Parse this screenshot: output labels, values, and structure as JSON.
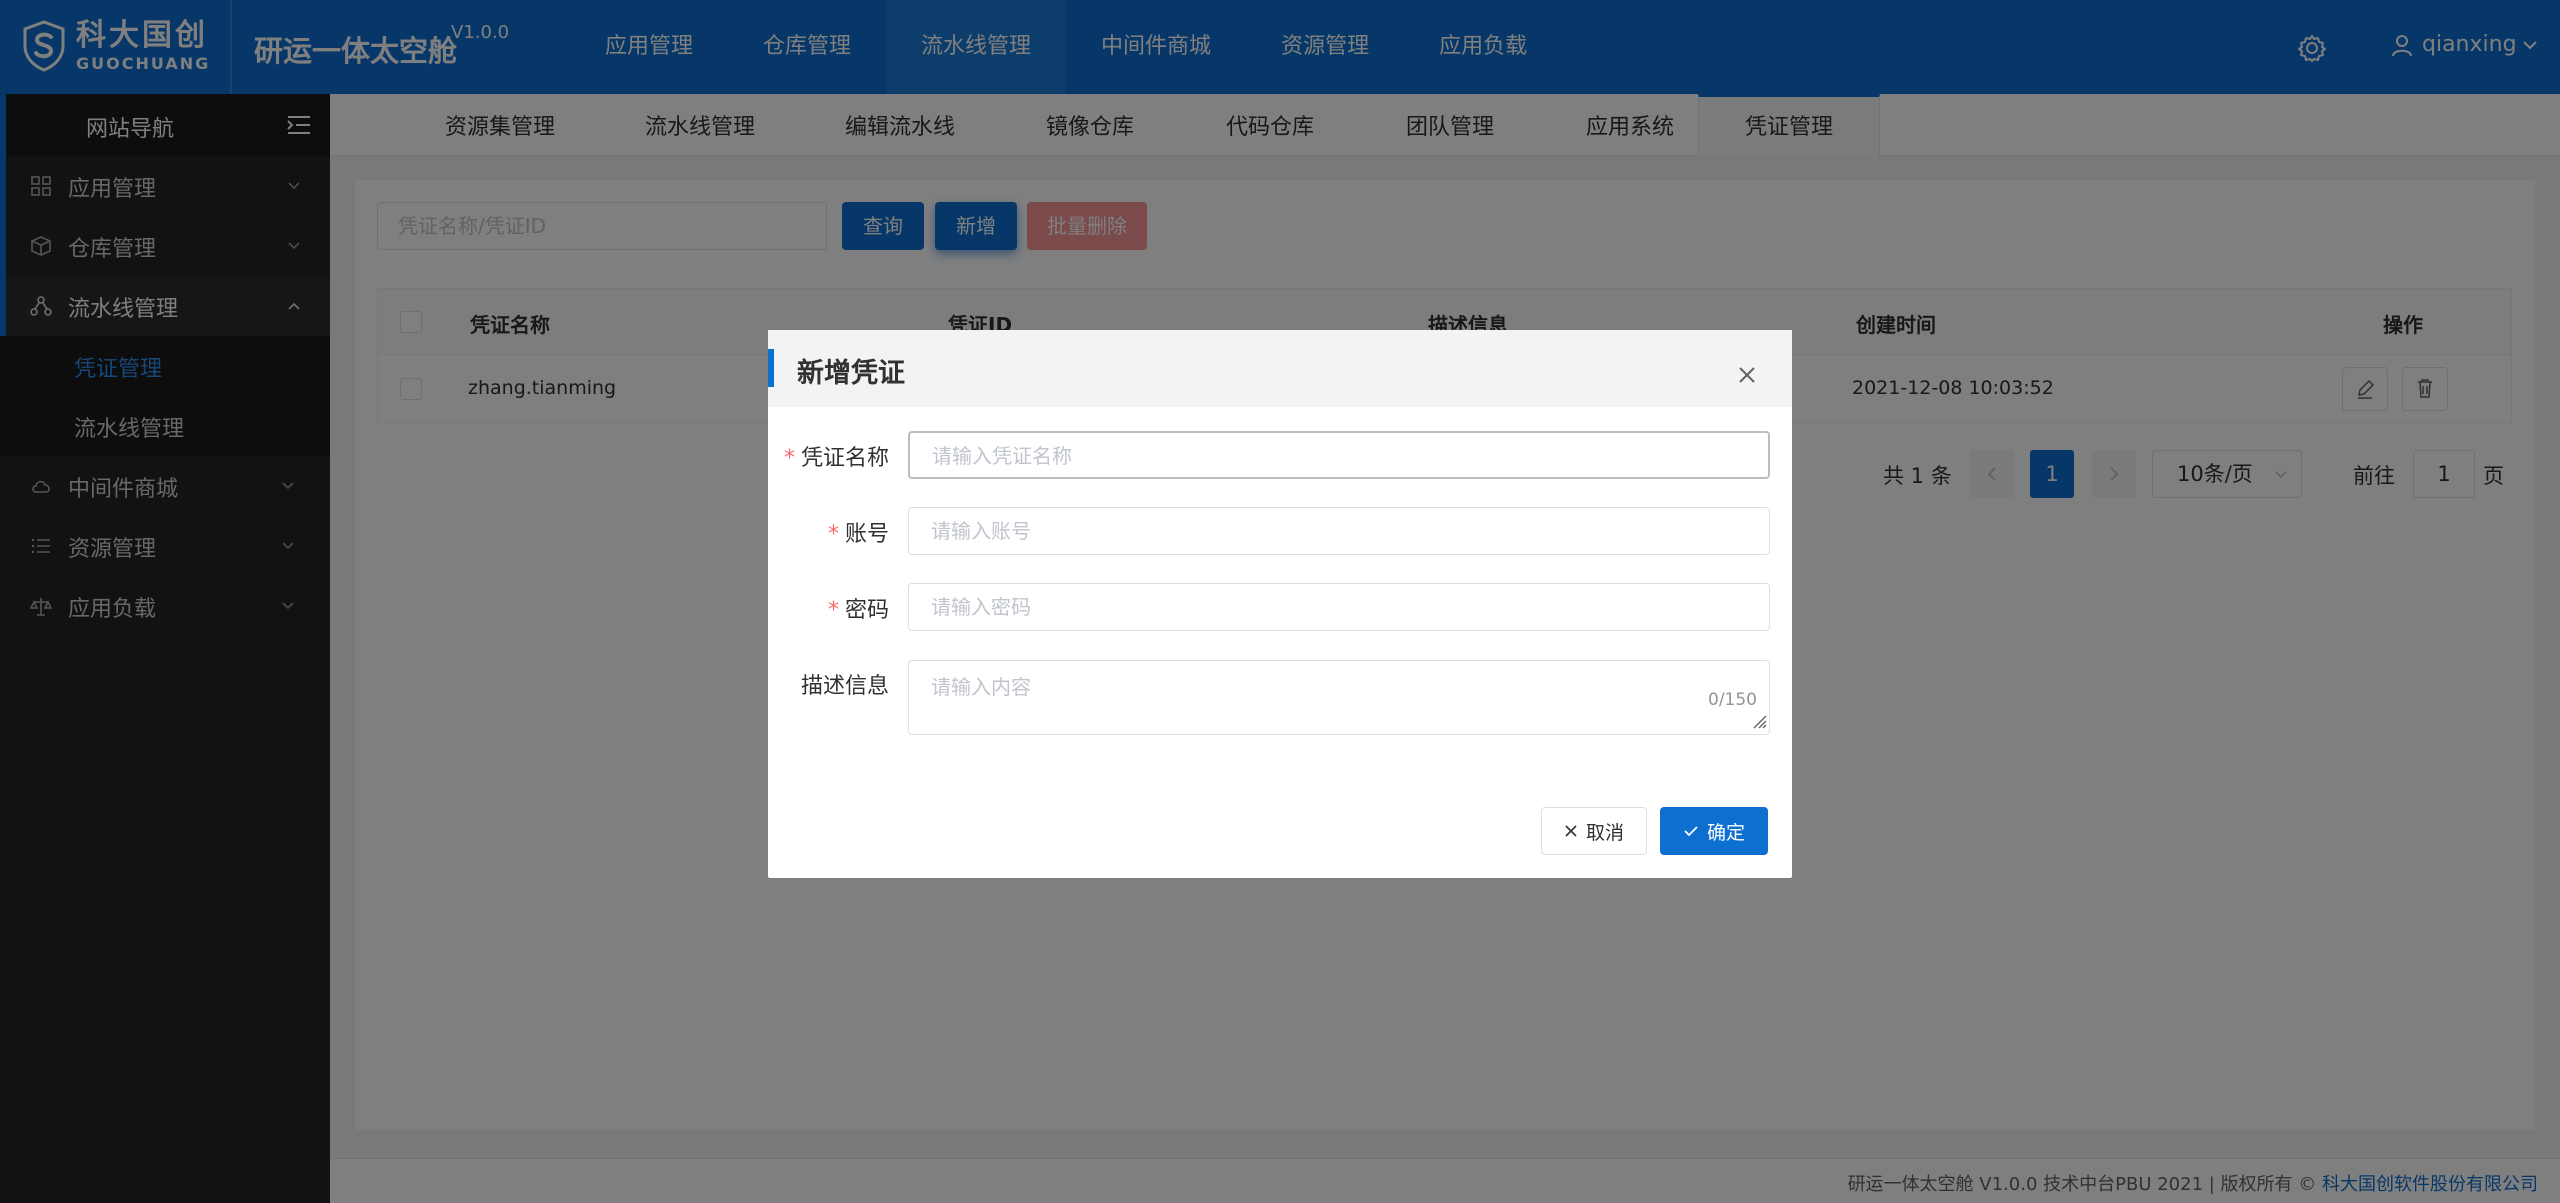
{
  "header": {
    "logo_cn": "科大国创",
    "logo_en": "GUOCHUANG",
    "app_title": "研运一体太空舱",
    "version": "V1.0.0",
    "nav": [
      "应用管理",
      "仓库管理",
      "流水线管理",
      "中间件商城",
      "资源管理",
      "应用负载"
    ],
    "active_nav": "流水线管理",
    "username": "qianxing",
    "icons": {
      "settings": "gear-icon",
      "user": "user-icon"
    }
  },
  "sidebar": {
    "title": "网站导航",
    "items": [
      {
        "label": "应用管理",
        "icon": "grid-icon"
      },
      {
        "label": "仓库管理",
        "icon": "cube-icon"
      },
      {
        "label": "流水线管理",
        "icon": "branch-icon",
        "open": true
      },
      {
        "label": "中间件商城",
        "icon": "cloud-icon"
      },
      {
        "label": "资源管理",
        "icon": "list-icon"
      },
      {
        "label": "应用负载",
        "icon": "balance-icon"
      }
    ],
    "submenu": [
      {
        "label": "凭证管理",
        "active": true
      },
      {
        "label": "流水线管理"
      }
    ]
  },
  "tabs": [
    "资源集管理",
    "流水线管理",
    "编辑流水线",
    "镜像仓库",
    "代码仓库",
    "团队管理",
    "应用系统",
    "凭证管理"
  ],
  "active_tab": "凭证管理",
  "toolbar": {
    "search_placeholder": "凭证名称/凭证ID",
    "query_label": "查询",
    "add_label": "新增",
    "batch_delete_label": "批量删除"
  },
  "table": {
    "columns": [
      "凭证名称",
      "凭证ID",
      "描述信息",
      "创建时间",
      "操作"
    ],
    "rows": [
      {
        "name": "zhang.tianming",
        "id": "",
        "desc": "",
        "created": "2021-12-08 10:03:52"
      }
    ]
  },
  "pagination": {
    "total": "共 1 条",
    "current": "1",
    "page_size": "10条/页",
    "goto_prefix": "前往",
    "goto_value": "1",
    "goto_suffix": "页"
  },
  "footer": {
    "text": "研运一体太空舱 V1.0.0 技术中台PBU 2021 | 版权所有 ©",
    "company": "科大国创软件股份有限公司"
  },
  "modal": {
    "title": "新增凭证",
    "fields": [
      {
        "label": "凭证名称",
        "required": true,
        "placeholder": "请输入凭证名称"
      },
      {
        "label": "账号",
        "required": true,
        "placeholder": "请输入账号"
      },
      {
        "label": "密码",
        "required": true,
        "placeholder": "请输入密码"
      },
      {
        "label": "描述信息",
        "required": false,
        "placeholder": "请输入内容",
        "counter": "0/150"
      }
    ],
    "required_mark": "*",
    "cancel_label": "取消",
    "ok_label": "确定"
  },
  "colors": {
    "primary": "#0d6fd0",
    "sidebar": "#242424",
    "danger": "#f56c6c"
  }
}
